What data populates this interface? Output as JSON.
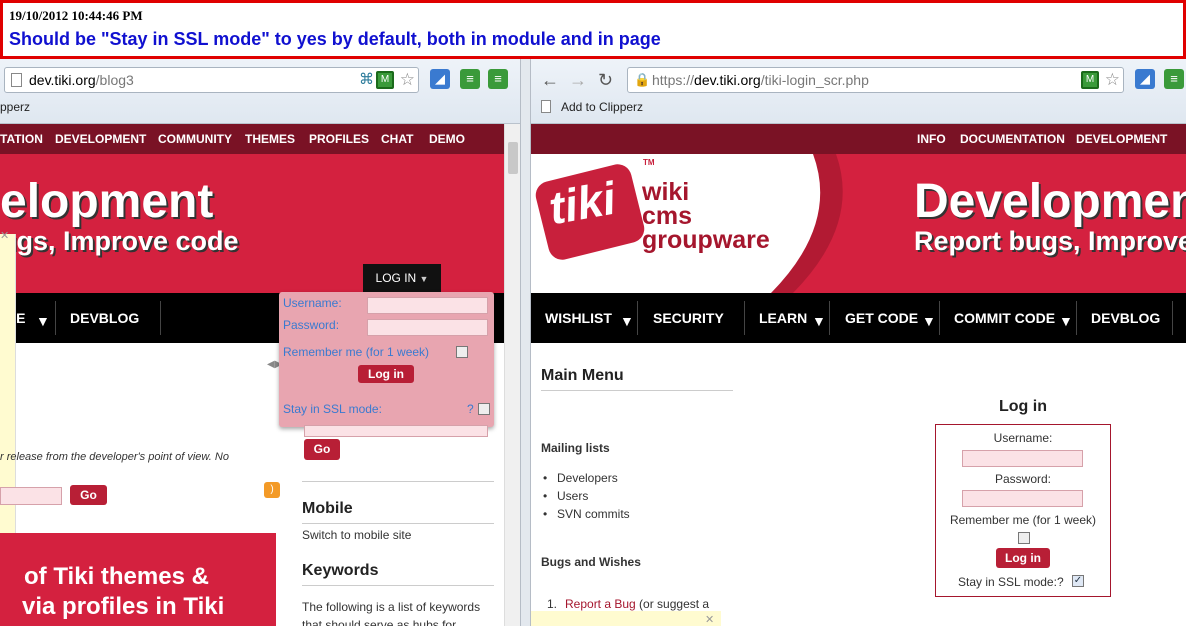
{
  "annotation": {
    "timestamp": "19/10/2012 10:44:46 PM",
    "message": "Should be \"Stay in SSL mode\" to yes by default, both in module and in page"
  },
  "left": {
    "url_host": "dev.tiki.org",
    "url_path": "/blog3",
    "bookmark": "pperz",
    "topnav": [
      "TATION",
      "DEVELOPMENT",
      "COMMUNITY",
      "THEMES",
      "PROFILES",
      "CHAT",
      "DEMO"
    ],
    "hero_title": "elopment",
    "hero_sub": "ugs, Improve code",
    "login_toggle": "LOG IN",
    "mainnav": [
      "DE",
      "DEVBLOG"
    ],
    "login_box": {
      "username_label": "Username:",
      "password_label": "Password:",
      "remember_label": "Remember me (for 1 week)",
      "login_button": "Log in",
      "ssl_label": "Stay in SSL mode:",
      "ssl_help": "?"
    },
    "go_button": "Go",
    "go_button2": "Go",
    "release_text": "r release from the developer's point of view. No",
    "mobile_title": "Mobile",
    "mobile_link": "Switch to mobile site",
    "keywords_title": "Keywords",
    "keywords_text1": "The following is a list of keywords",
    "keywords_text2": "that should serve as hubs for",
    "promo_line1": "of Tiki themes &",
    "promo_line2": "via profiles in Tiki"
  },
  "right": {
    "url_scheme": "https://",
    "url_host": "dev.tiki.org",
    "url_path": "/tiki-login_scr.php",
    "bookmark": "Add to Clipperz",
    "topnav": [
      "INFO",
      "DOCUMENTATION",
      "DEVELOPMENT"
    ],
    "logo_word": "tiki",
    "logo_tm": "TM",
    "logo_lines": [
      "wiki",
      "cms",
      "groupware"
    ],
    "hero_title": "Developmen",
    "hero_sub": "Report bugs, Improve",
    "mainnav": [
      "WISHLIST",
      "SECURITY",
      "LEARN",
      "GET CODE",
      "COMMIT CODE",
      "DEVBLOG"
    ],
    "main_menu_title": "Main Menu",
    "mailing_title": "Mailing lists",
    "mailing_items": [
      "Developers",
      "Users",
      "SVN commits"
    ],
    "bugs_title": "Bugs and Wishes",
    "bugs_item_link": "Report a Bug",
    "bugs_item_rest": " (or suggest a",
    "login": {
      "title": "Log in",
      "username_label": "Username:",
      "password_label": "Password:",
      "remember_label": "Remember me (for 1 week)",
      "login_button": "Log in",
      "ssl_label": "Stay in SSL mode:?",
      "ssl_checked": true
    }
  },
  "colors": {
    "brand_red": "#d4213f",
    "dark_red": "#7a1225",
    "annotation_red": "#e00000",
    "annotation_blue": "#1010d0"
  }
}
